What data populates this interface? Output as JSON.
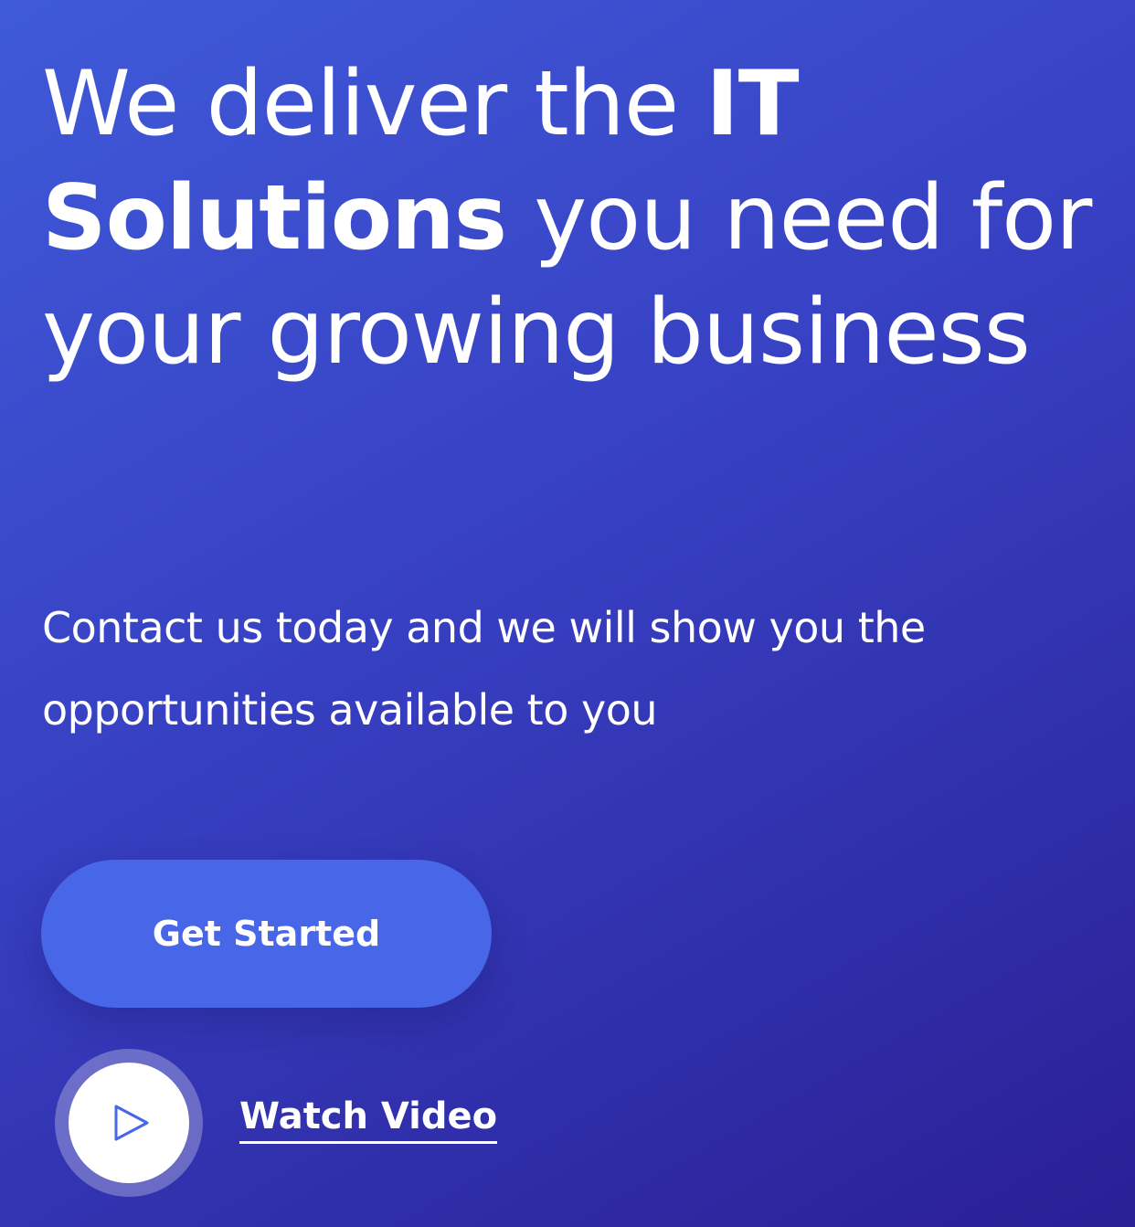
{
  "hero": {
    "headline": {
      "part1": "We deliver the ",
      "emphasis": "IT Solutions",
      "part2": " you need for your growing business"
    },
    "subtext": "Contact us today and we will show you the opportunities available to you",
    "cta_label": "Get Started",
    "watch_label": "Watch Video"
  },
  "icons": {
    "play": "play-icon"
  },
  "colors": {
    "gradient_start": "#3f5ad9",
    "gradient_end": "#2a1f95",
    "button": "#4766e8",
    "play_icon": "#4766e8",
    "text": "#ffffff"
  }
}
